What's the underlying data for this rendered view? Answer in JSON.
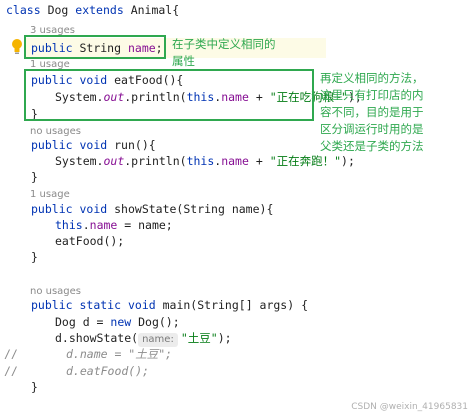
{
  "code": {
    "l1": {
      "kw1": "class",
      "name": "Dog",
      "kw2": "extends",
      "parent": "Animal{"
    },
    "hint_3_usages": "3 usages",
    "l2": {
      "kw": "public",
      "type": "String",
      "field": "name",
      "semi": ";"
    },
    "hint_1_usage_a": "1 usage",
    "l3": {
      "kw1": "public",
      "kw2": "void",
      "sig": "eatFood(){"
    },
    "l4": {
      "a": "System.",
      "out": "out",
      "b": ".println(",
      "this": "this",
      "dot": ".",
      "field": "name",
      "plus": " + ",
      "str": "\"正在吃狗粮~\"",
      "end": ");"
    },
    "l5": "}",
    "hint_no_usages_a": "no usages",
    "l6": {
      "kw1": "public",
      "kw2": "void",
      "sig": "run(){"
    },
    "l7": {
      "a": "System.",
      "out": "out",
      "b": ".println(",
      "this": "this",
      "dot": ".",
      "field": "name",
      "plus": " + ",
      "str": "\"正在奔跑！\"",
      "end": ");"
    },
    "l8": "}",
    "hint_1_usage_b": "1 usage",
    "l9": {
      "kw1": "public",
      "kw2": "void",
      "sig": "showState(String name){"
    },
    "l10": {
      "this": "this",
      "dot": ".",
      "field": "name",
      "rest": " = name;"
    },
    "l11": "eatFood();",
    "l12": "}",
    "hint_no_usages_b": "no usages",
    "l13": {
      "kw1": "public",
      "kw2": "static",
      "kw3": "void",
      "sig": "main(String[] args) {"
    },
    "l14": {
      "type": "Dog d = ",
      "kw": "new",
      "rest": " Dog();"
    },
    "l15": {
      "a": "d.showState(",
      "param_hint": "name:",
      "str": "\"土豆\"",
      "end": ");"
    },
    "l16": {
      "gutter": "//",
      "text": "d.name = \"土豆\";"
    },
    "l17": {
      "gutter": "//",
      "text": "d.eatFood();"
    },
    "l18": "}"
  },
  "notes": {
    "field_note_line1": "在子类中定义相同的",
    "field_note_line2": "属性",
    "method_note_line1": "再定义相同的方法，",
    "method_note_line2": "这里只有打印店的内",
    "method_note_line3": "容不同，目的是用于",
    "method_note_line4": "区分调运行时用的是",
    "method_note_line5": "父类还是子类的方法"
  },
  "watermark": "CSDN @weixin_41965831",
  "colors": {
    "annotation_green": "#2fa84f",
    "keyword": "#0033b3",
    "string": "#067d17",
    "field": "#871094"
  }
}
